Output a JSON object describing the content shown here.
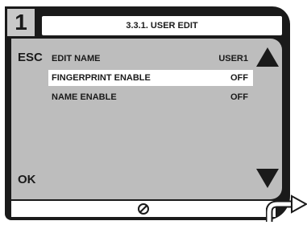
{
  "step": {
    "number": "1"
  },
  "header": {
    "title": "3.3.1. USER EDIT"
  },
  "softkeys": {
    "esc": "ESC",
    "ok": "OK"
  },
  "menu": {
    "items": [
      {
        "label": "EDIT NAME",
        "value": "USER1",
        "selected": false
      },
      {
        "label": "FINGERPRINT ENABLE",
        "value": "OFF",
        "selected": true
      },
      {
        "label": "NAME ENABLE",
        "value": "OFF",
        "selected": false
      }
    ]
  },
  "icons": {
    "scroll_up": "triangle-up-icon",
    "scroll_down": "triangle-down-icon",
    "bottom": "no-sign-icon",
    "exit": "curved-arrow-right-icon"
  },
  "colors": {
    "frame": "#1a1a1a",
    "screen": "#bdbdbd",
    "highlight": "#ffffff"
  }
}
